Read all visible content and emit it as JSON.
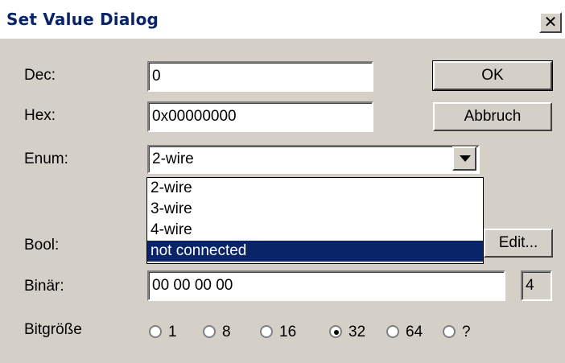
{
  "window": {
    "title": "Set Value Dialog",
    "close_glyph": "✕"
  },
  "fields": {
    "dec": {
      "label": "Dec:",
      "value": "0"
    },
    "hex": {
      "label": "Hex:",
      "value": "0x00000000"
    },
    "enum": {
      "label": "Enum:",
      "value": "2-wire",
      "options": [
        "2-wire",
        "3-wire",
        "4-wire",
        "not connected"
      ],
      "highlighted": "not connected"
    },
    "bool": {
      "label": "Bool:"
    },
    "binaer": {
      "label": "Binär:",
      "value": "00 00 00 00",
      "size_value": "4"
    },
    "bitgroesse": {
      "label": "Bitgröße",
      "options": [
        "1",
        "8",
        "16",
        "32",
        "64",
        "?"
      ],
      "selected": "32"
    }
  },
  "buttons": {
    "ok": "OK",
    "cancel": "Abbruch",
    "edit": "Edit..."
  },
  "colors": {
    "highlight": "#0a246a",
    "title_text": "#0a246a",
    "face": "#d4d0c8"
  }
}
